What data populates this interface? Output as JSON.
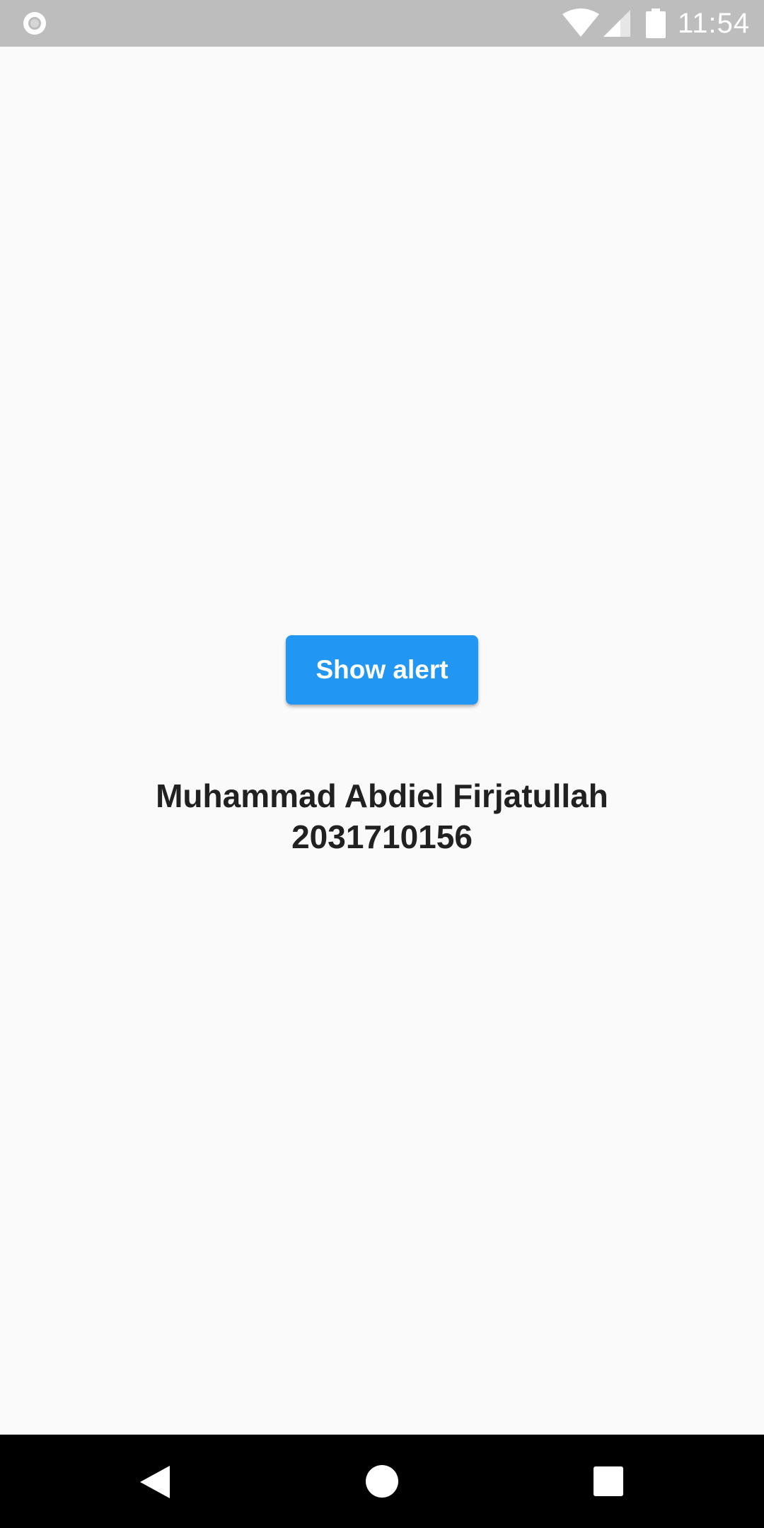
{
  "status_bar": {
    "time": "11:54",
    "icons": {
      "left": "circle-notification-icon",
      "wifi": "wifi-icon",
      "signal": "cell-signal-icon",
      "battery": "battery-icon"
    }
  },
  "main": {
    "alert_button_label": "Show alert",
    "name": "Muhammad Abdiel Firjatullah",
    "student_id": "2031710156"
  },
  "nav_bar": {
    "icons": [
      "back-icon",
      "home-icon",
      "recents-icon"
    ]
  },
  "colors": {
    "accent": "#2196f3",
    "status_bar": "#bdbdbd",
    "background": "#fafafa",
    "text": "#212121",
    "nav_bar": "#000000"
  }
}
